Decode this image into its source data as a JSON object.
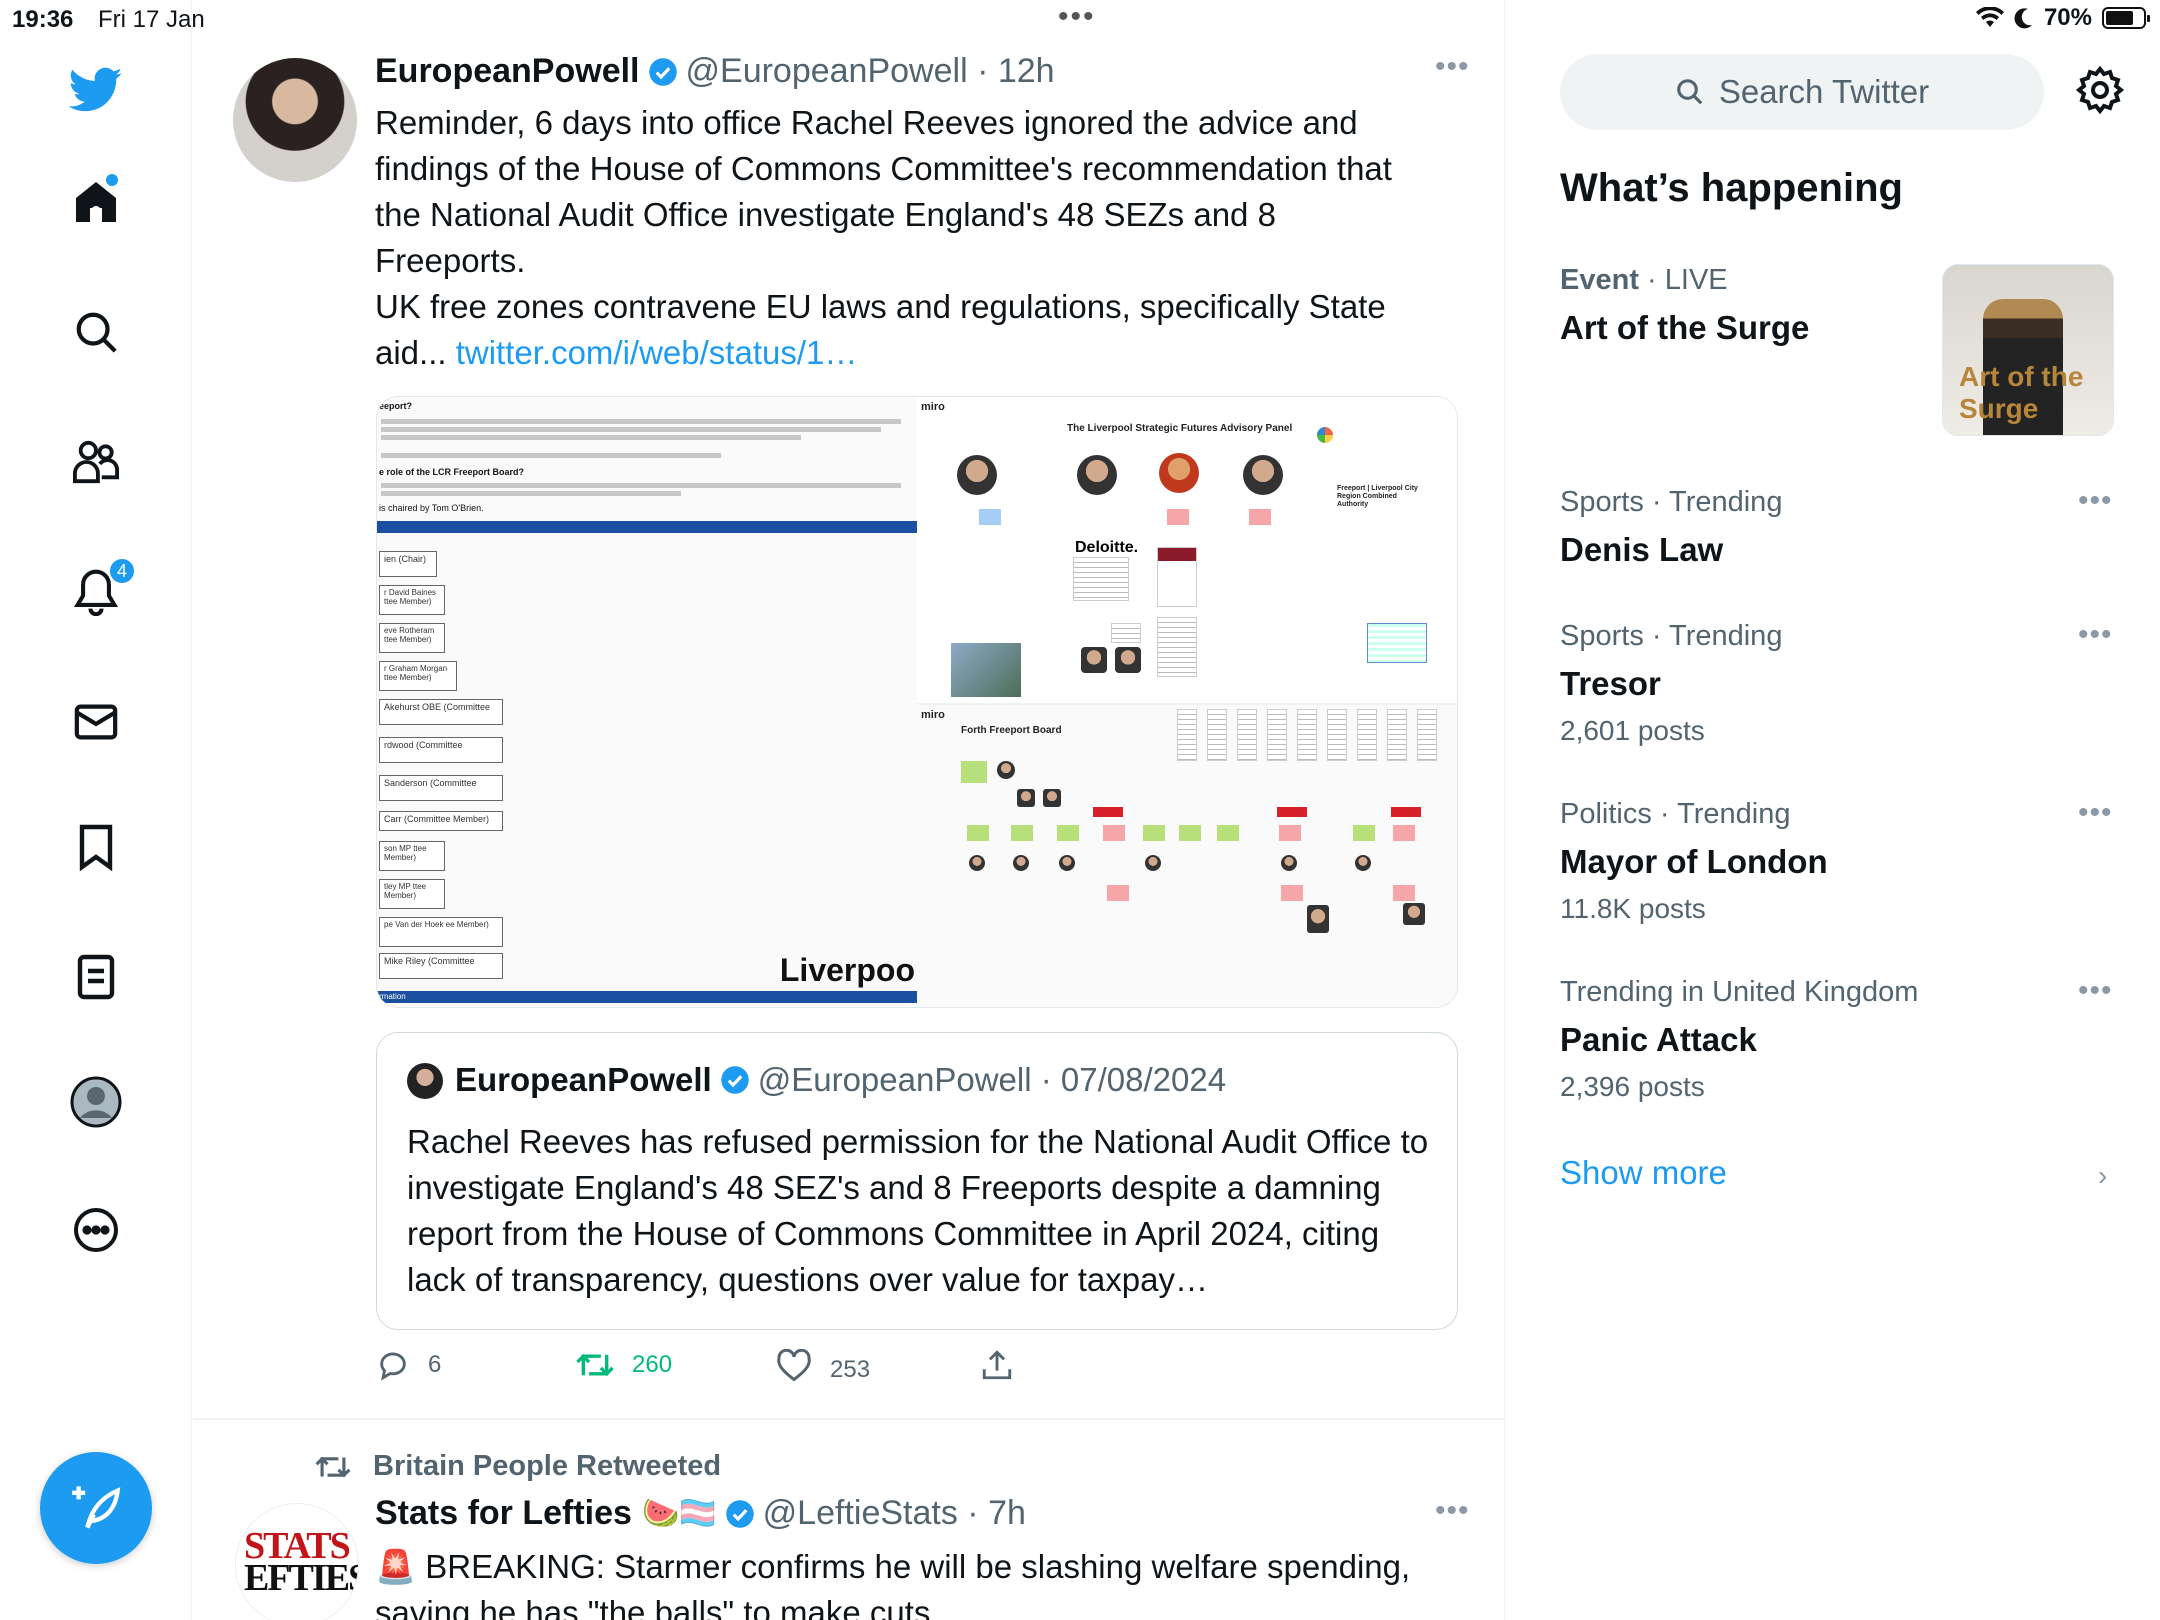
{
  "status_bar": {
    "time": "19:36",
    "date": "Fri 17 Jan",
    "battery": "70%"
  },
  "nav": {
    "notifications_badge": "4"
  },
  "tweet1": {
    "name": "EuropeanPowell",
    "handle": "@EuropeanPowell",
    "time": "12h",
    "text": "Reminder, 6 days into office Rachel Reeves ignored the advice and findings of the House of Commons Committee's recommendation that the National Audit Office investigate England's 48 SEZs and 8 Freeports.\nUK free zones contravene EU laws and regulations, specifically State aid... ",
    "link": "twitter.com/i/web/status/1…",
    "media": {
      "left_heading": "eeport?",
      "left_q": "e role of the LCR Freeport Board?",
      "left_chair": "is chaired by Tom O'Brien.",
      "members": [
        "ien  (Chair)",
        "r David Baines\nttee Member)",
        "eve Rotheram\nttee Member)",
        "r Graham Morgan\nttee Member)",
        "Akehurst OBE  (Committee",
        "rdwood  (Committee",
        "Sanderson  (Committee",
        "Carr  (Committee Member)",
        "son MP\nttee Member)",
        "tley MP\nttee Member)",
        "pe Van der Hoek\nee Member)",
        "Mike Riley  (Committee"
      ],
      "left_footer": "rmation",
      "left_brand": "Liverpoo",
      "board1_app": "miro",
      "board1_title": "The Liverpool Strategic Futures Advisory Panel",
      "board1_logo": "Deloitte.",
      "board1_side": "Freeport | Liverpool City Region Combined Authority",
      "board2_app": "miro",
      "board2_title": "Forth Freeport Board"
    },
    "quote": {
      "name": "EuropeanPowell",
      "handle": "@EuropeanPowell",
      "date": "07/08/2024",
      "text": "Rachel Reeves has refused permission for the National Audit Office to investigate England's 48 SEZ's and 8 Freeports despite a damning report from the House of Commons Committee in April 2024, citing lack of transparency, questions over value for taxpay…"
    },
    "actions": {
      "replies": "6",
      "retweets": "260",
      "likes": "253"
    }
  },
  "tweet2": {
    "retweeted_by": "Britain People Retweeted",
    "name": "Stats for Lefties",
    "emojis": "🍉🏳️‍⚧️",
    "handle": "@LeftieStats",
    "time": "7h",
    "avatar_text_1": "STATS",
    "avatar_text_2": "EFTIES",
    "text": "🚨 BREAKING: Starmer confirms he will be slashing welfare spending, saying he has \"the balls\" to make cuts"
  },
  "sidebar": {
    "search_placeholder": "Search Twitter",
    "title": "What’s happening",
    "trends": [
      {
        "category": "Event",
        "extra": "LIVE",
        "name": "Art of the Surge",
        "posts": ""
      },
      {
        "category": "Sports · Trending",
        "extra": "",
        "name": "Denis Law",
        "posts": ""
      },
      {
        "category": "Sports · Trending",
        "extra": "",
        "name": "Tresor",
        "posts": "2,601 posts"
      },
      {
        "category": "Politics · Trending",
        "extra": "",
        "name": "Mayor of London",
        "posts": "11.8K posts"
      },
      {
        "category": "Trending in United Kingdom",
        "extra": "",
        "name": "Panic Attack",
        "posts": "2,396 posts"
      }
    ],
    "trend_image_text": "Art of the Surge",
    "show_more": "Show more"
  },
  "colors": {
    "accent": "#1d9bf0",
    "retweet": "#00ba7c",
    "secondary_text": "#536471"
  }
}
